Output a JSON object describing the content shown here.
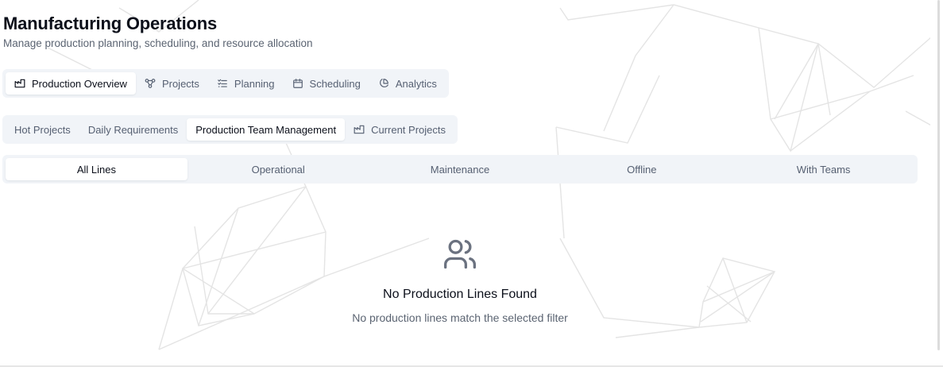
{
  "header": {
    "title": "Manufacturing Operations",
    "subtitle": "Manage production planning, scheduling, and resource allocation"
  },
  "main_tabs": [
    {
      "label": "Production Overview",
      "icon": "factory-icon",
      "active": true
    },
    {
      "label": "Projects",
      "icon": "workflow-icon",
      "active": false
    },
    {
      "label": "Planning",
      "icon": "list-checks-icon",
      "active": false
    },
    {
      "label": "Scheduling",
      "icon": "calendar-icon",
      "active": false
    },
    {
      "label": "Analytics",
      "icon": "pie-chart-icon",
      "active": false
    }
  ],
  "sub_tabs": [
    {
      "label": "Hot Projects",
      "active": false
    },
    {
      "label": "Daily Requirements",
      "active": false
    },
    {
      "label": "Production Team Management",
      "active": true
    },
    {
      "label": "Current Projects",
      "icon": "factory-icon",
      "active": false
    }
  ],
  "filter_tabs": [
    {
      "label": "All Lines",
      "active": true
    },
    {
      "label": "Operational",
      "active": false
    },
    {
      "label": "Maintenance",
      "active": false
    },
    {
      "label": "Offline",
      "active": false
    },
    {
      "label": "With Teams",
      "active": false
    }
  ],
  "empty_state": {
    "icon": "users-icon",
    "title": "No Production Lines Found",
    "description": "No production lines match the selected filter"
  },
  "colors": {
    "tab_bar_bg": "#f1f4f8",
    "muted_text": "#566072",
    "icon_gray": "#6b7280"
  }
}
